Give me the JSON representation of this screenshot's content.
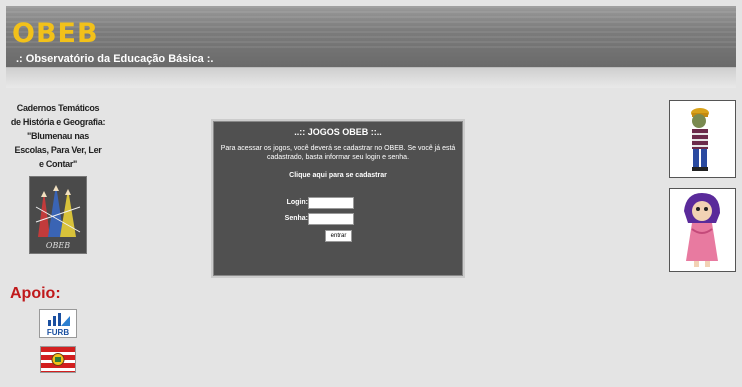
{
  "header": {
    "logo": "OBEB",
    "subtitle": ".: Observatório da Educação Básica :."
  },
  "sidebar": {
    "caderno_lines": [
      "Cadernos Temáticos",
      "de História e Geografia:",
      "\"Blumenau nas",
      "Escolas, Para Ver, Ler",
      "e Contar\""
    ],
    "caderno_logo_label": "OBEB",
    "apoio_label": "Apoio:",
    "sponsor1_label": "FURB"
  },
  "panel": {
    "title": "..:: JOGOS OBEB ::..",
    "text": "Para acessar os jogos, você deverá se cadastrar no OBEB. Se você já está cadastrado, basta informar seu login e senha.",
    "register_link": "Clique aqui para se cadastrar",
    "login_label": "Login:",
    "login_value": "",
    "senha_label": "Senha:",
    "senha_value": "",
    "submit_label": "entrar"
  },
  "colors": {
    "accent": "#f2c11a",
    "apoio": "#c0191b",
    "panel_bg": "#505050"
  }
}
